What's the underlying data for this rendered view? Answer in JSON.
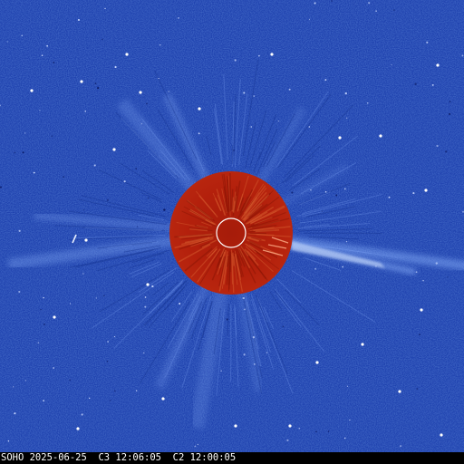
{
  "image": {
    "caption": "SOHO 2025-06-25  C3 12:06:05  C2 12:00:05",
    "colors": {
      "background": "#1c3fae",
      "occulter": "#b3200c",
      "sun_outline": "#ffffff",
      "caption_text": "#ffffff",
      "caption_bar": "#000000"
    }
  }
}
